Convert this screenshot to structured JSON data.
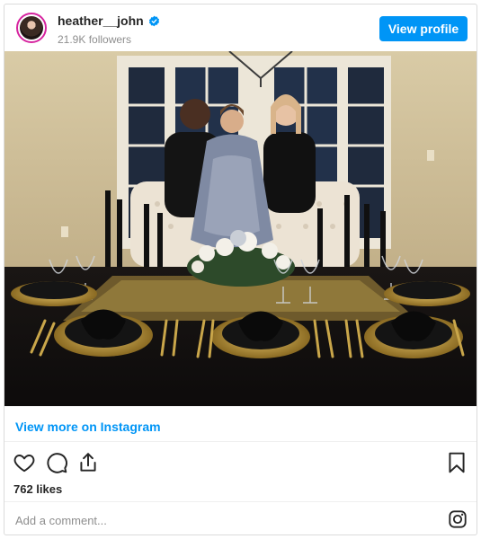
{
  "header": {
    "username": "heather__john",
    "verified": true,
    "followers": "21.9K followers",
    "view_profile_label": "View profile"
  },
  "post": {
    "view_more_label": "View more on Instagram",
    "likes": "762 likes"
  },
  "comment": {
    "placeholder": "Add a comment..."
  },
  "icons": {
    "like": "heart-icon",
    "comment": "comment-icon",
    "share": "share-icon",
    "save": "bookmark-icon",
    "instagram": "instagram-logo-icon"
  },
  "colors": {
    "accent": "#0095f6",
    "text": "#262626",
    "muted": "#8e8e8e",
    "border": "#dbdbdb"
  }
}
